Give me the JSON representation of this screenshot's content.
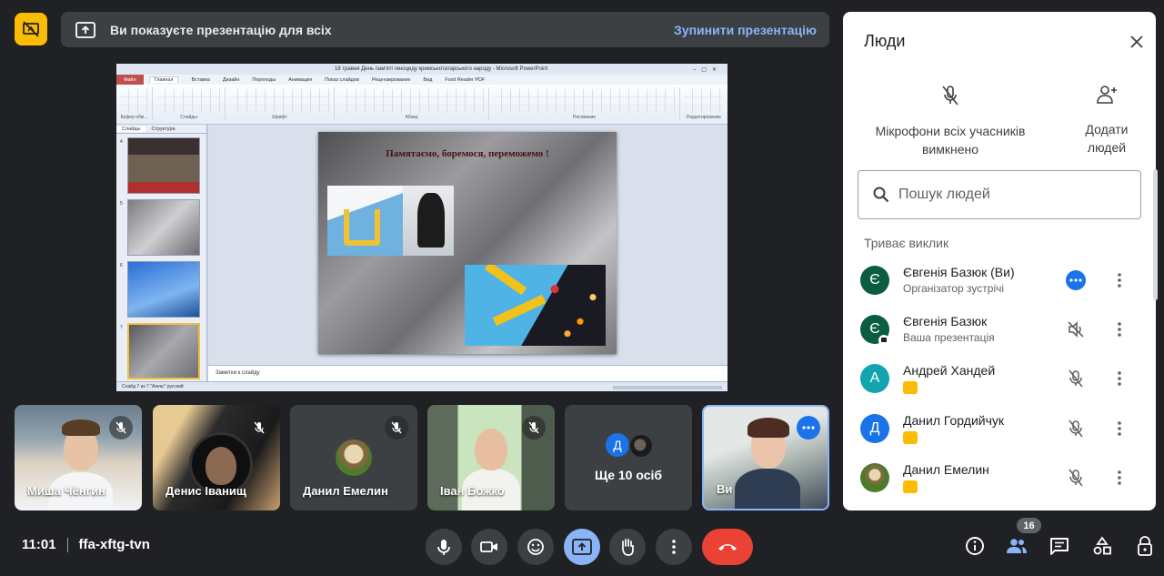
{
  "banner": {
    "text": "Ви показуєте презентацію для всіх",
    "stop": "Зупинити презентацію"
  },
  "presentation": {
    "window_title": "18 травня День пам'яті геноциду кримськотатарського народу - Microsoft PowerPoint",
    "tabs": [
      "Файл",
      "Главная",
      "Вставка",
      "Дизайн",
      "Переходы",
      "Анимация",
      "Показ слайдов",
      "Рецензирование",
      "Вид",
      "Foxit Reader PDF"
    ],
    "ribbon_groups": [
      "Буфер обм...",
      "Слайды",
      "Шрифт",
      "Абзац",
      "Рисование",
      "Редактирование"
    ],
    "side_tabs": [
      "Слайды",
      "Структура"
    ],
    "slide_numbers": [
      "4",
      "5",
      "6",
      "7"
    ],
    "slide_title": "Памятаємо, боремося, переможемо !",
    "notes": "Заметки к слайду",
    "status": "Слайд 7 из 7   \"Апекс\"   русский"
  },
  "tiles": [
    {
      "name": "Миша Чёнгин"
    },
    {
      "name": "Денис Іванищ"
    },
    {
      "name": "Данил Емелин"
    },
    {
      "name": "Іван Божко"
    },
    {
      "name": "Ще 10 осіб",
      "initial": "Д"
    },
    {
      "name": "Ви"
    }
  ],
  "bottom": {
    "time": "11:01",
    "meeting_code": "ffa-xftg-tvn",
    "participant_count": "16"
  },
  "panel": {
    "title": "Люди",
    "mute_all_label": "Мікрофони всіх учасників вимкнено",
    "add_people_label": "Додати людей",
    "search_placeholder": "Пошук людей",
    "section_label": "Триває виклик",
    "people": [
      {
        "initial": "Є",
        "name": "Євгенія Базюк (Ви)",
        "sub": "Організатор зустрічі",
        "color": "#0b5d3f"
      },
      {
        "initial": "Є",
        "name": "Євгенія Базюк",
        "sub": "Ваша презентація",
        "color": "#0b5d3f"
      },
      {
        "initial": "А",
        "name": "Андрей Хандей",
        "sub": "",
        "color": "#12a4af"
      },
      {
        "initial": "Д",
        "name": "Данил Гордийчук",
        "sub": "",
        "color": "#1a73e8"
      },
      {
        "initial": "",
        "name": "Данил Емелин",
        "sub": "",
        "color": "#6b7f3a"
      }
    ]
  },
  "colors": {
    "background": "#202124",
    "accent": "#8ab4f8",
    "hangup": "#ea4335",
    "badge": "#fbbc04"
  }
}
